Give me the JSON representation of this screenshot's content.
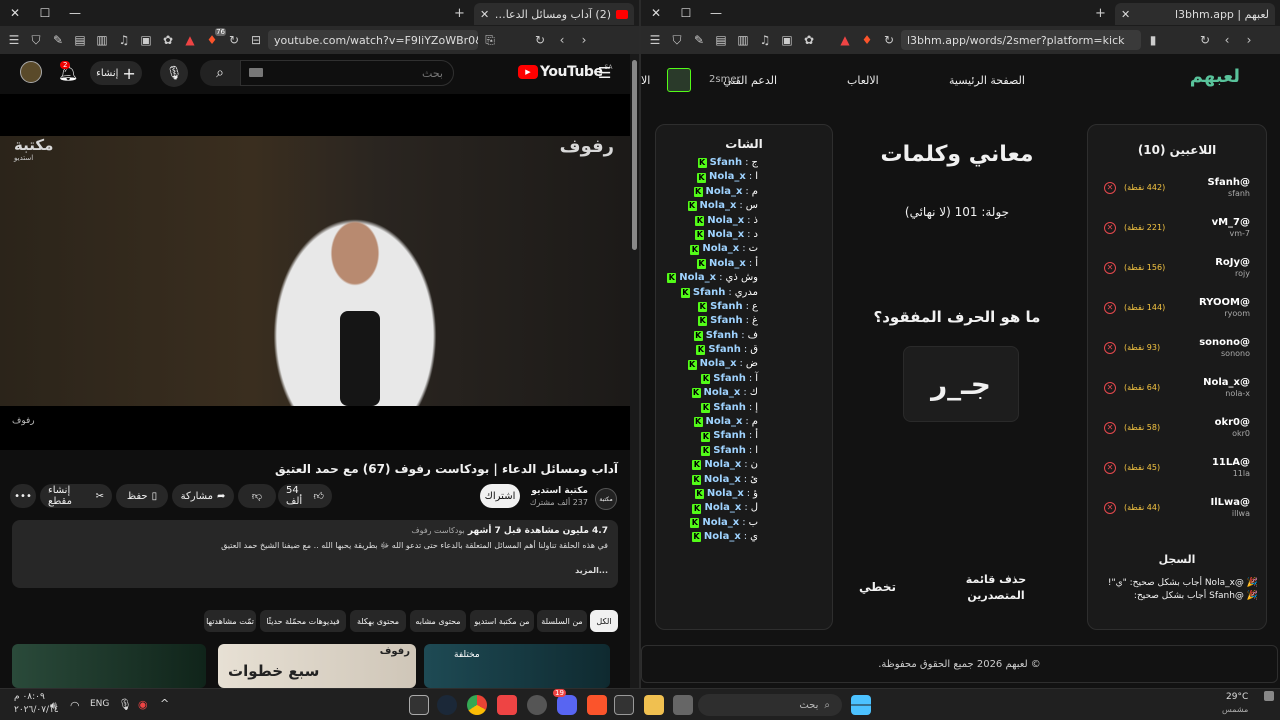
{
  "left_window": {
    "tab_title": "(2) آداب ومسائل الدعاء | بودكا...",
    "url": "youtube.com/watch?v=F9IiYZoWBr0&t=3...",
    "brave_badge": "76",
    "youtube": {
      "logo_text": "YouTube",
      "logo_region": "SA",
      "search_placeholder": "بحث",
      "create_label": "إنشاء",
      "notifications_count": "2",
      "video_title": "آداب ومسائل الدعاء | بودكاست رفوف (67) مع حمد العتيق",
      "channel_name": "مكتبة استديو",
      "channel_subs": "237 ألف مشترك",
      "subscribe_label": "اشتراك",
      "likes": "54 ألف",
      "share_label": "مشاركة",
      "save_label": "حفظ",
      "clip_label": "إنشاء مقطع",
      "views_line": "4.7 مليون مشاهدة قبل 7 أشهر",
      "hashtag": "بودكاست رفوف",
      "description": "في هذه الحلقة تناولنا أهم المسائل المتعلقة بالدعاء حتى تدعو الله ﷻ بطريقة يحبها الله .. مع ضيفنا الشيخ حمد العتيق",
      "more_label": "...المزيد",
      "watermark_left": "مكتبة",
      "watermark_left_sub": "استديو",
      "watermark_right": "رفوف",
      "watermark_bottom": "رفوف",
      "chips": [
        "الكل",
        "من السلسلة",
        "من مكتبة استديو",
        "محتوى مشابه",
        "محتوى بهكلة",
        "فيديوهات محمّلة حديثًا",
        "تمّت مشاهدتها"
      ],
      "thumb_texts": [
        "مختلفة",
        "سبع خطوات",
        "رفوف"
      ]
    }
  },
  "right_window": {
    "tab_title": "لعبهم | l3bhm.app",
    "url": "l3bhm.app/words/2smer?platform=kick",
    "nav": {
      "logo": "لعبهم",
      "home": "الصفحة الرئيسية",
      "games": "الالعاب",
      "support": "الدعم الفني",
      "user": "2smer",
      "cut": "الا"
    },
    "players_title": "اللاعبين (10)",
    "players": [
      {
        "name": "@Sfanh",
        "id": "sfanh",
        "points": "(442 نقطة)"
      },
      {
        "name": "@vM_7",
        "id": "vm-7",
        "points": "(221 نقطة)"
      },
      {
        "name": "@RoJy",
        "id": "rojy",
        "points": "(156 نقطة)"
      },
      {
        "name": "@RYOOM",
        "id": "ryoom",
        "points": "(144 نقطة)"
      },
      {
        "name": "@sonono",
        "id": "sonono",
        "points": "(93 نقطة)"
      },
      {
        "name": "@Nola_x",
        "id": "nola-x",
        "points": "(64 نقطة)"
      },
      {
        "name": "@okr0",
        "id": "okr0",
        "points": "(58 نقطة)"
      },
      {
        "name": "@11LA",
        "id": "11la",
        "points": "(45 نقطة)"
      },
      {
        "name": "@IlLwa",
        "id": "illwa",
        "points": "(44 نقطة)"
      }
    ],
    "log_title": "السجل",
    "log": [
      "🎉 @Nola_x أجاب بشكل صحيح: \"ي\"!",
      "🎉 @Sfanh أجاب بشكل صحيح:"
    ],
    "game_title": "معاني وكلمات",
    "round": "جولة: 101 (لا نهائي)",
    "question": "ما هو الحرف المفقود؟",
    "puzzle": "جـ_ر",
    "skip_label": "تخطي",
    "clear_board_label": "حذف قائمة المتصدرين",
    "chat_title": "الشات",
    "chat": [
      {
        "user": "Sfanh",
        "msg": "ج"
      },
      {
        "user": "Nola_x",
        "msg": "ا"
      },
      {
        "user": "Nola_x",
        "msg": "م"
      },
      {
        "user": "Nola_x",
        "msg": "س"
      },
      {
        "user": "Nola_x",
        "msg": "ذ"
      },
      {
        "user": "Nola_x",
        "msg": "د"
      },
      {
        "user": "Nola_x",
        "msg": "ت"
      },
      {
        "user": "Nola_x",
        "msg": "أ"
      },
      {
        "user": "Nola_x",
        "msg": "وش ذي"
      },
      {
        "user": "Sfanh",
        "msg": "مدري"
      },
      {
        "user": "Sfanh",
        "msg": "ع"
      },
      {
        "user": "Sfanh",
        "msg": "غ"
      },
      {
        "user": "Sfanh",
        "msg": "ف"
      },
      {
        "user": "Sfanh",
        "msg": "ق"
      },
      {
        "user": "Nola_x",
        "msg": "ض"
      },
      {
        "user": "Sfanh",
        "msg": "آ"
      },
      {
        "user": "Nola_x",
        "msg": "ك"
      },
      {
        "user": "Sfanh",
        "msg": "إ"
      },
      {
        "user": "Nola_x",
        "msg": "م"
      },
      {
        "user": "Sfanh",
        "msg": "أ"
      },
      {
        "user": "Sfanh",
        "msg": "ا"
      },
      {
        "user": "Nola_x",
        "msg": "ن"
      },
      {
        "user": "Nola_x",
        "msg": "ئ"
      },
      {
        "user": "Nola_x",
        "msg": "ؤ"
      },
      {
        "user": "Nola_x",
        "msg": "ل"
      },
      {
        "user": "Nola_x",
        "msg": "ب"
      },
      {
        "user": "Nola_x",
        "msg": "ي"
      }
    ],
    "footer": "© لعبهم 2026 جميع الحقوق محفوظة."
  },
  "taskbar": {
    "time": "٠٨:٠٩ م",
    "date": "٢٠٢٦/٠٧/١٤",
    "lang": "ENG",
    "search_label": "بحث",
    "weather_temp": "29°C",
    "weather_desc": "مشمس",
    "discord_badge": "19"
  },
  "colors": {
    "kick_green": "#53fc18",
    "yt_red": "#ff0000",
    "points_gold": "#f5c542",
    "remove_red": "#e5484d"
  }
}
